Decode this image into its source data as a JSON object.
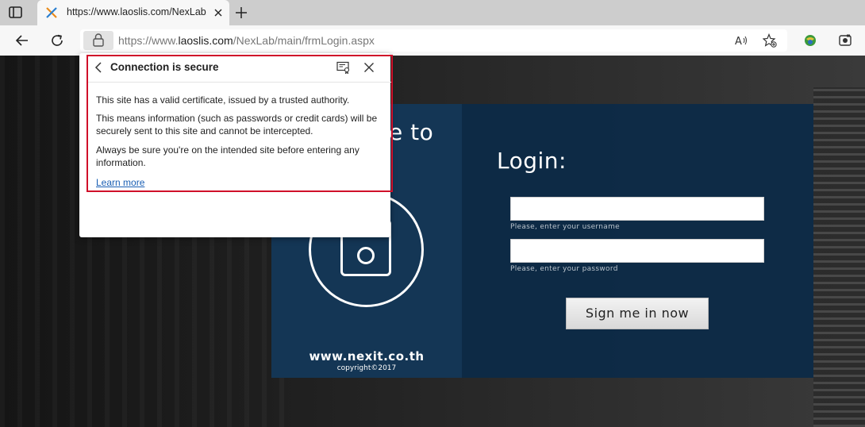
{
  "browser": {
    "tab": {
      "title": "https://www.laoslis.com/NexLab/"
    },
    "address": {
      "prefix": "https://www.",
      "host": "laoslis.com",
      "path": "/NexLab/main/frmLogin.aspx"
    }
  },
  "security_popup": {
    "title": "Connection is secure",
    "paragraphs": [
      "This site has a valid certificate, issued by a trusted authority.",
      "This means information (such as passwords or credit cards) will be securely sent to this site and cannot be intercepted.",
      "Always be sure you're on the intended site before entering any information."
    ],
    "learn_more": "Learn more",
    "outline_color": "#d0102a"
  },
  "page": {
    "welcome_text": "e to",
    "brand_url": "www.nexit.co.th",
    "copyright": "copyright©2017",
    "login": {
      "title": "Login:",
      "username_hint": "Please, enter your username",
      "password_hint": "Please, enter your password",
      "username_value": "",
      "password_value": "",
      "submit_label": "Sign me in now"
    },
    "colors": {
      "panel_left": "#143655",
      "panel_right": "#0d2b47"
    }
  }
}
